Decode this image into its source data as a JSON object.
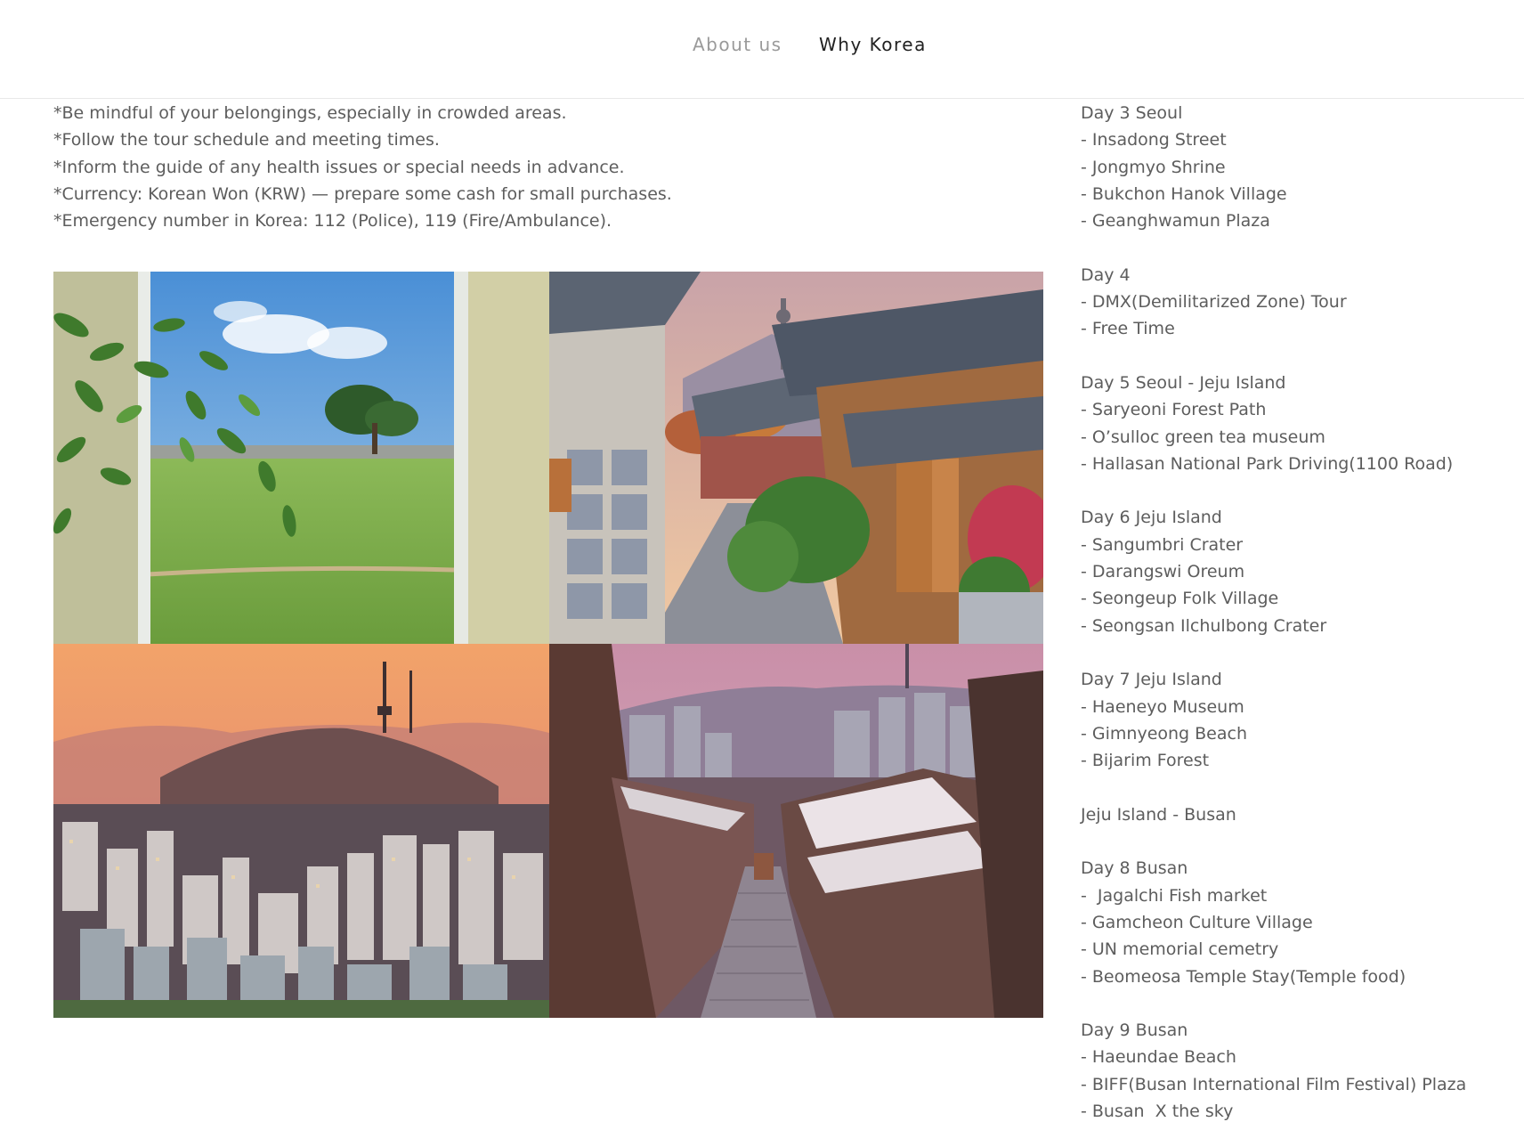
{
  "nav": {
    "about": "About us",
    "why": "Why Korea"
  },
  "notes": [
    "*Be mindful of your belongings, especially in crowded areas.",
    "*Follow the tour schedule and meeting times.",
    "*Inform the guide of any health issues or special needs in advance.",
    "*Currency: Korean Won (KRW) — prepare some cash for small purchases.",
    "*Emergency number in Korea: 112 (Police), 119 (Fire/Ambulance)."
  ],
  "gallery": [
    {
      "name": "window-view-photo",
      "icon": "park-through-window"
    },
    {
      "name": "hanok-village-photo",
      "icon": "bukchon-hanok-street"
    },
    {
      "name": "seoul-skyline-photo",
      "icon": "seoul-sunset-namsan-tower"
    },
    {
      "name": "hanok-alley-photo",
      "icon": "hanok-alley-dusk"
    }
  ],
  "itinerary": [
    "Day 3 Seoul",
    "- Insadong Street",
    "- Jongmyo Shrine",
    "- Bukchon Hanok Village",
    "- Geanghwamun Plaza",
    "",
    "Day 4",
    "- DMX(Demilitarized Zone) Tour",
    "- Free Time",
    "",
    "Day 5 Seoul - Jeju Island",
    "- Saryeoni Forest Path",
    "- O’sulloc green tea museum",
    "- Hallasan National Park Driving(1100 Road)",
    "",
    "Day 6 Jeju Island",
    "- Sangumbri Crater",
    "- Darangswi Oreum",
    "- Seongeup Folk Village",
    "- Seongsan Ilchulbong Crater",
    "",
    "Day 7 Jeju Island",
    "- Haeneyo Museum",
    "- Gimnyeong Beach",
    "- Bijarim Forest",
    "",
    "Jeju Island - Busan",
    "",
    "Day 8 Busan",
    "-  Jagalchi Fish market",
    "- Gamcheon Culture Village",
    "- UN memorial cemetry",
    "- Beomeosa Temple Stay(Temple food)",
    "",
    "Day 9 Busan",
    "- Haeundae Beach",
    "- BIFF(Busan International Film Festival) Plaza",
    "- Busan  X the sky"
  ]
}
